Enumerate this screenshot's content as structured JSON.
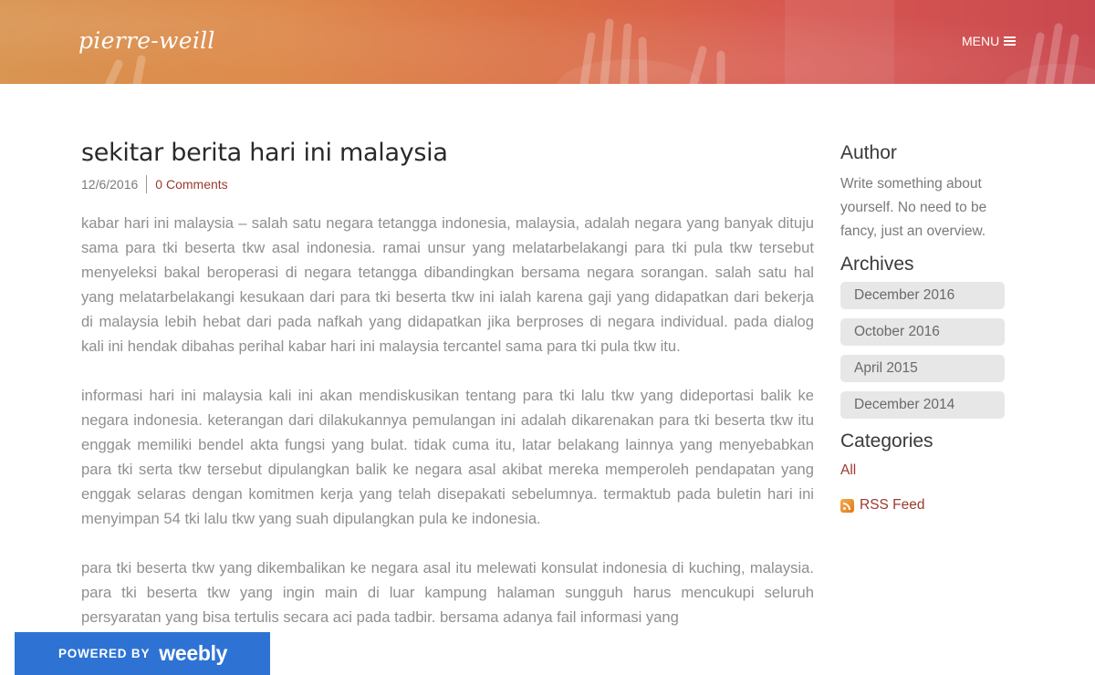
{
  "header": {
    "site_title": "pierre-weill",
    "menu_label": "MENU",
    "gradient_colors": [
      "#d99552",
      "#d96a3f",
      "#c9484f"
    ]
  },
  "post": {
    "title": "sekitar berita hari ini malaysia",
    "date": "12/6/2016",
    "comments": "0 Comments",
    "paragraphs": [
      "kabar hari ini malaysia – salah satu negara tetangga indonesia, malaysia, adalah negara yang banyak dituju sama para tki beserta tkw asal indonesia. ramai unsur yang melatarbelakangi para tki pula tkw tersebut menyeleksi bakal beroperasi di negara tetangga dibandingkan bersama negara sorangan. salah satu hal yang melatarbelakangi kesukaan dari para tki beserta tkw ini ialah karena gaji yang didapatkan dari bekerja di malaysia lebih hebat dari pada nafkah yang didapatkan jika berproses di negara individual. pada dialog kali ini hendak dibahas perihal kabar hari ini malaysia tercantel sama para tki pula tkw itu.",
      "informasi hari ini malaysia kali ini akan mendiskusikan tentang para tki lalu tkw yang dideportasi balik ke negara indonesia. keterangan dari dilakukannya pemulangan ini adalah dikarenakan para tki beserta tkw itu enggak memiliki bendel akta fungsi yang bulat. tidak cuma itu, latar belakang lainnya yang menyebabkan para tki serta tkw tersebut dipulangkan balik ke negara asal akibat mereka memperoleh pendapatan yang enggak selaras dengan komitmen kerja yang telah disepakati sebelumnya. termaktub pada buletin hari ini menyimpan 54 tki lalu tkw yang suah dipulangkan pula ke indonesia.",
      "para tki beserta tkw yang dikembalikan ke negara asal itu melewati konsulat indonesia di kuching, malaysia. para tki beserta tkw yang ingin main di luar kampung halaman sungguh harus mencukupi seluruh persyaratan yang bisa tertulis secara aci pada tadbir. bersama adanya fail informasi yang"
    ]
  },
  "sidebar": {
    "author_heading": "Author",
    "author_text": "Write something about yourself. No need to be fancy, just an overview.",
    "archives_heading": "Archives",
    "archives": [
      "December 2016",
      "October 2016",
      "April 2015",
      "December 2014"
    ],
    "categories_heading": "Categories",
    "category_all": "All",
    "rss_label": "RSS Feed"
  },
  "footer_badge": {
    "powered_by": "POWERED BY",
    "brand": "weebly",
    "color": "#2e73d4"
  },
  "colors": {
    "accent_link": "#9b3a2e",
    "body_text": "#8f8f8f",
    "archive_bg": "#e7e7e7"
  }
}
